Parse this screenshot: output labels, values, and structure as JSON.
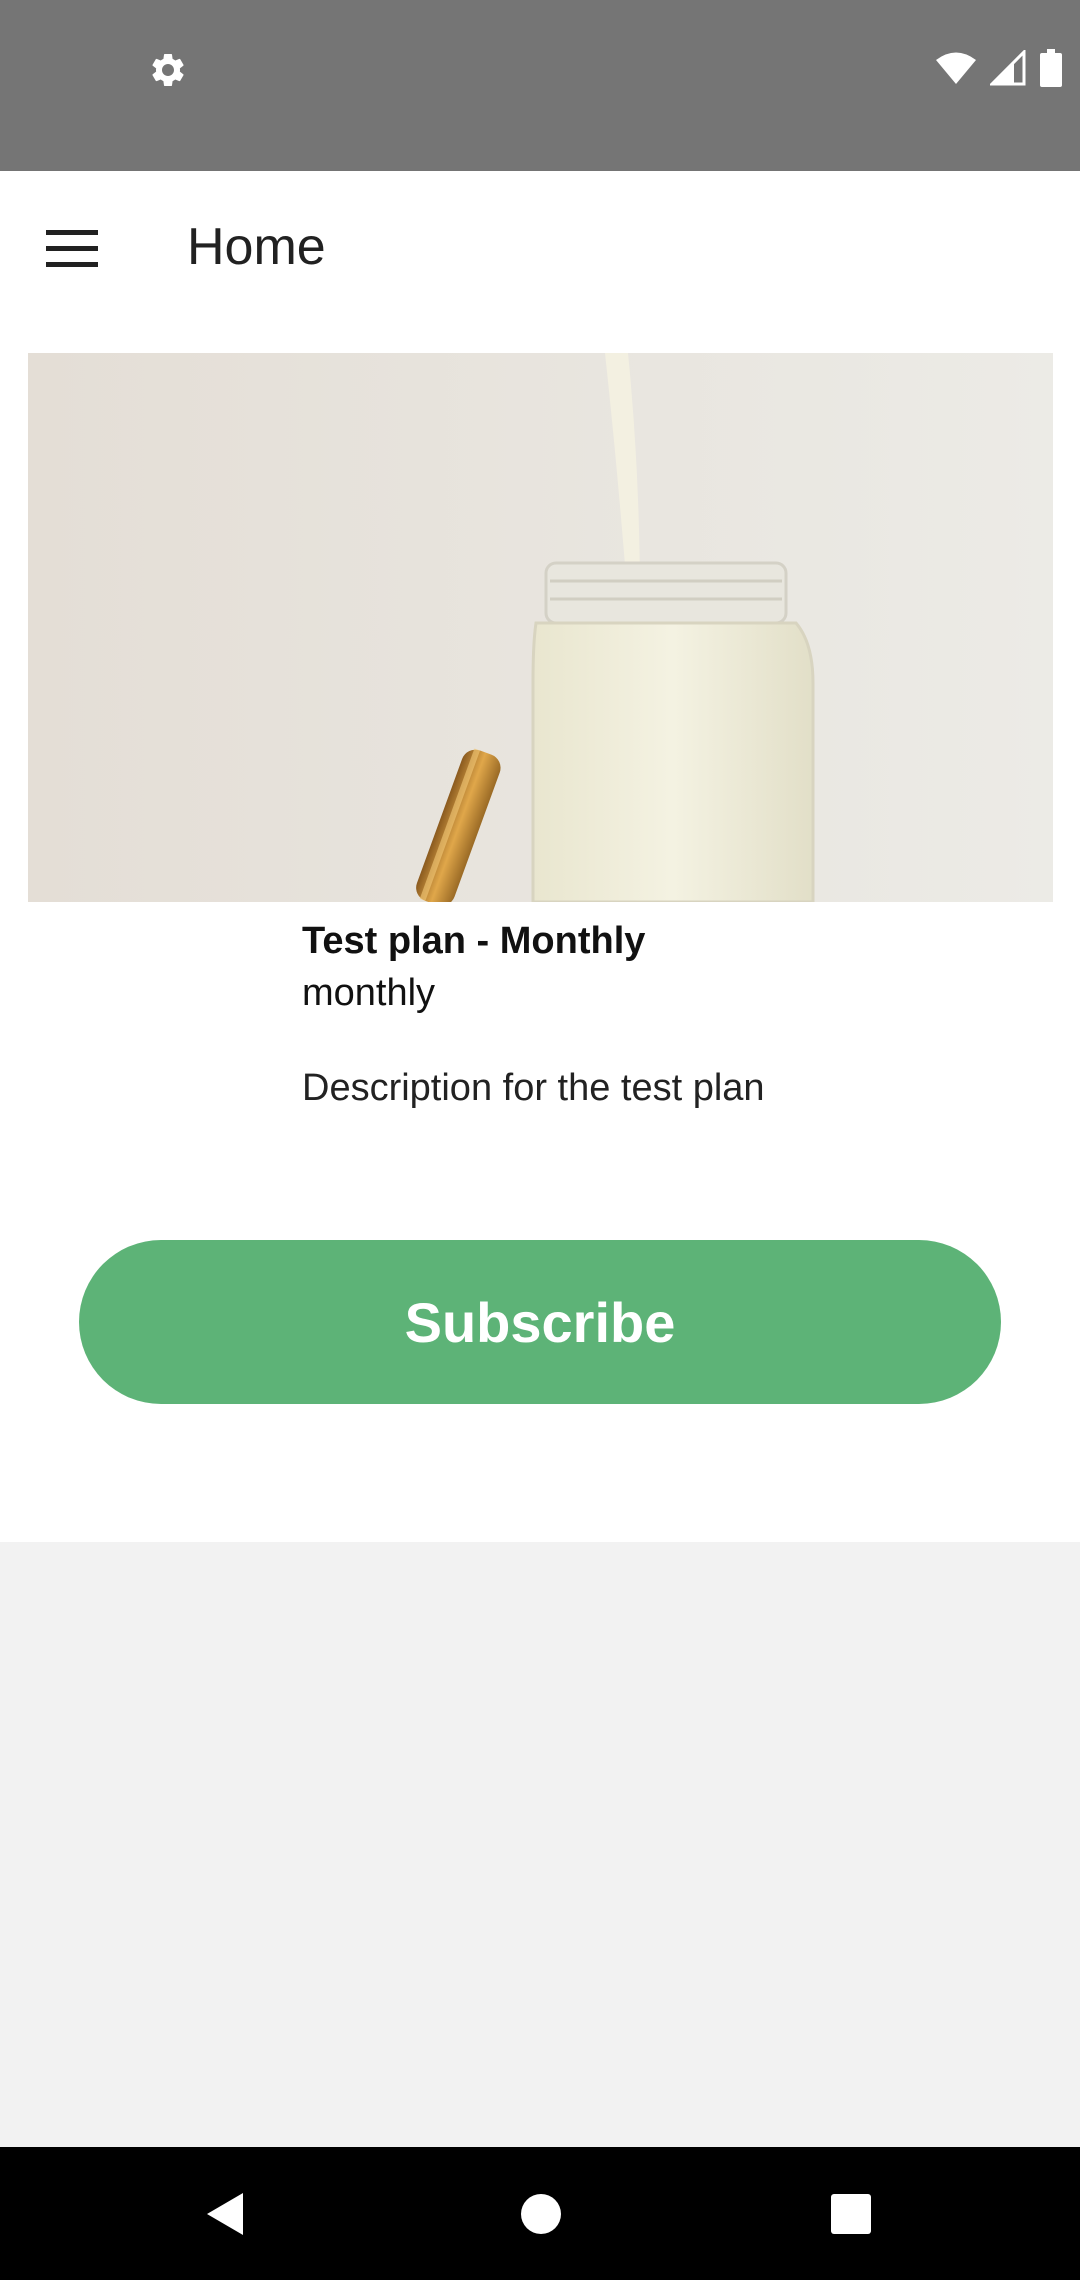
{
  "status_bar": {
    "icons": [
      "settings-gear-icon",
      "wifi-icon",
      "cellular-signal-icon",
      "battery-icon"
    ],
    "background": "#757575"
  },
  "app_bar": {
    "title": "Home",
    "menu_icon": "hamburger-menu-icon"
  },
  "plan": {
    "image": "milk-jar-photo",
    "title": "Test plan - Monthly",
    "interval": "monthly",
    "description": "Description for the test plan"
  },
  "actions": {
    "subscribe_label": "Subscribe",
    "accent_color": "#5db377"
  },
  "nav_bar": {
    "buttons": [
      "back-icon",
      "home-icon",
      "recents-icon"
    ]
  }
}
